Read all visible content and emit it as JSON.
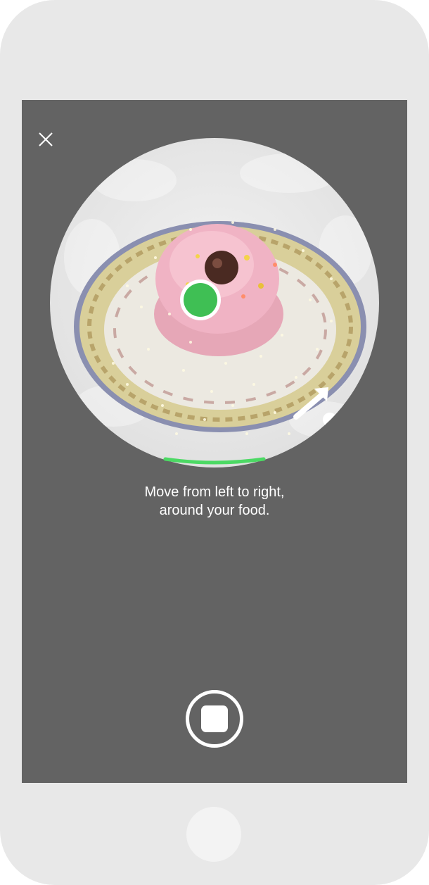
{
  "device": {
    "frame_color": "#e8e8e8",
    "screen_color": "#636363"
  },
  "camera": {
    "close_icon": "close-icon",
    "instruction": {
      "line1": "Move from left to right,",
      "line2": "around your food."
    },
    "progress_color": "#4cd964",
    "focus_indicator_color": "#3fbf54",
    "capture_button_icon": "stop-square-icon",
    "direction_icon": "arrow-up-right-icon"
  },
  "home_button": {
    "icon": "home-button"
  }
}
